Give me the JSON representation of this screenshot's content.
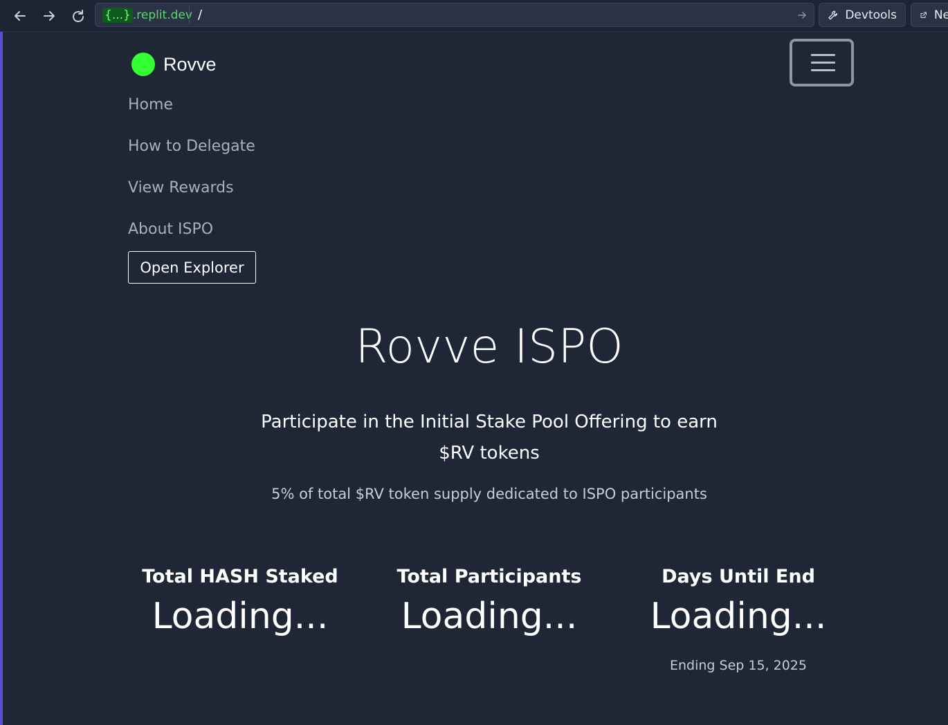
{
  "browser": {
    "url_domain_badge": "{...}",
    "url_domain": ".replit.dev",
    "url_path": "/",
    "devtools_label": "Devtools",
    "new_tab_label": "Ne"
  },
  "navbar": {
    "brand": "Rovve",
    "brand_color": "#33ff33",
    "links": [
      "Home",
      "How to Delegate",
      "View Rewards",
      "About ISPO"
    ],
    "explorer_button": "Open Explorer"
  },
  "hero": {
    "title": "Rovve ISPO",
    "subtitle": "Participate in the Initial Stake Pool Offering to earn $RV tokens",
    "note": "5% of total $RV token supply dedicated to ISPO participants"
  },
  "stats": [
    {
      "label": "Total HASH Staked",
      "value": "Loading..."
    },
    {
      "label": "Total Participants",
      "value": "Loading..."
    },
    {
      "label": "Days Until End",
      "value": "Loading...",
      "footnote": "Ending Sep 15, 2025"
    }
  ]
}
